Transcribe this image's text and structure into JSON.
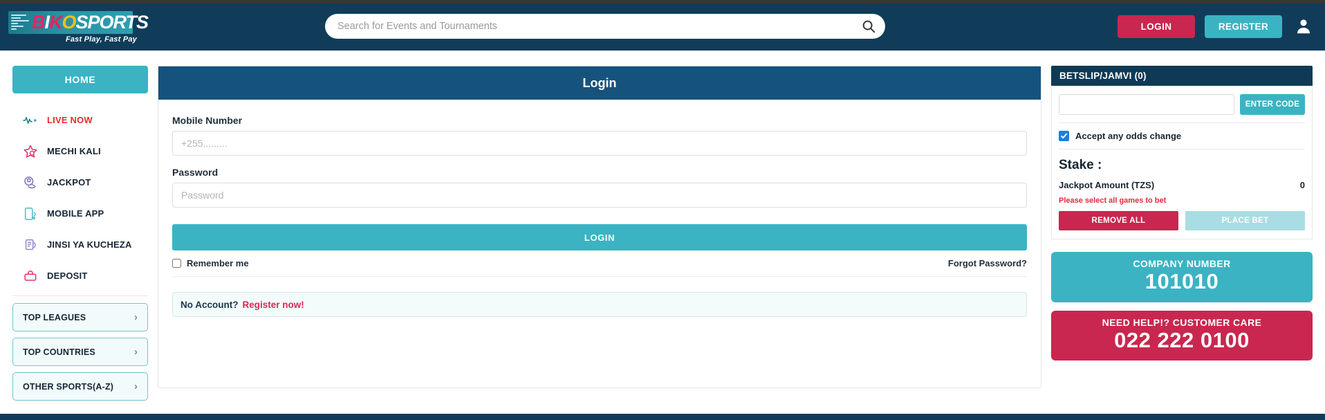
{
  "header": {
    "logo": {
      "b": "B",
      "i": "I",
      "k": "K",
      "o": "O",
      "sports": "SPORTS",
      "tagline": "Fast Play, Fast Pay"
    },
    "search": {
      "placeholder": "Search for Events and Tournaments",
      "value": "",
      "icon": "search-icon"
    },
    "login_label": "LOGIN",
    "register_label": "REGISTER",
    "account_icon": "user-icon"
  },
  "sidebar": {
    "home_label": "HOME",
    "items": [
      {
        "label": "LIVE NOW",
        "icon": "pulse-icon"
      },
      {
        "label": "MECHI KALI",
        "icon": "star-icon"
      },
      {
        "label": "JACKPOT",
        "icon": "football-icon"
      },
      {
        "label": "MOBILE APP",
        "icon": "mobile-icon"
      },
      {
        "label": "JINSI YA KUCHEZA",
        "icon": "how-to-play-icon"
      },
      {
        "label": "DEPOSIT",
        "icon": "wallet-icon"
      }
    ],
    "accordions": [
      {
        "label": "TOP LEAGUES",
        "chevron": "›"
      },
      {
        "label": "TOP COUNTRIES",
        "chevron": "›"
      },
      {
        "label": "OTHER SPORTS(A-Z)",
        "chevron": "›"
      }
    ]
  },
  "login_panel": {
    "title": "Login",
    "mobile_label": "Mobile Number",
    "mobile_placeholder": "+255.........",
    "mobile_value": "",
    "password_label": "Password",
    "password_placeholder": "Password",
    "password_value": "",
    "submit_label": "LOGIN",
    "remember_label": "Remember me",
    "remember_checked": false,
    "forgot_label": "Forgot Password?",
    "no_account_question": "No Account?",
    "no_account_action": "Register now!"
  },
  "betslip": {
    "title": "BETSLIP/JAMVI (0)",
    "code_placeholder": "",
    "code_value": "",
    "enter_code_label": "ENTER CODE",
    "odds_change_label": "Accept any odds change",
    "odds_change_checked": true,
    "stake_label": "Stake :",
    "jackpot_amount_label": "Jackpot Amount (TZS)",
    "jackpot_amount_value": "0",
    "warning": "Please select all games to bet",
    "remove_all_label": "REMOVE ALL",
    "place_bet_label": "PLACE BET"
  },
  "promos": [
    {
      "title": "COMPANY NUMBER",
      "number": "101010",
      "style": "teal"
    },
    {
      "title": "NEED HELP!? CUSTOMER CARE",
      "number": "022 222 0100",
      "style": "red"
    }
  ],
  "colors": {
    "header_navy": "#103c5a",
    "panel_navy": "#15537d",
    "betslip_navy": "#0f3a56",
    "teal": "#3bb3c3",
    "crimson": "#c9274f",
    "live_red": "#ef2b2b",
    "place_bet_disabled": "#a8dde3"
  }
}
